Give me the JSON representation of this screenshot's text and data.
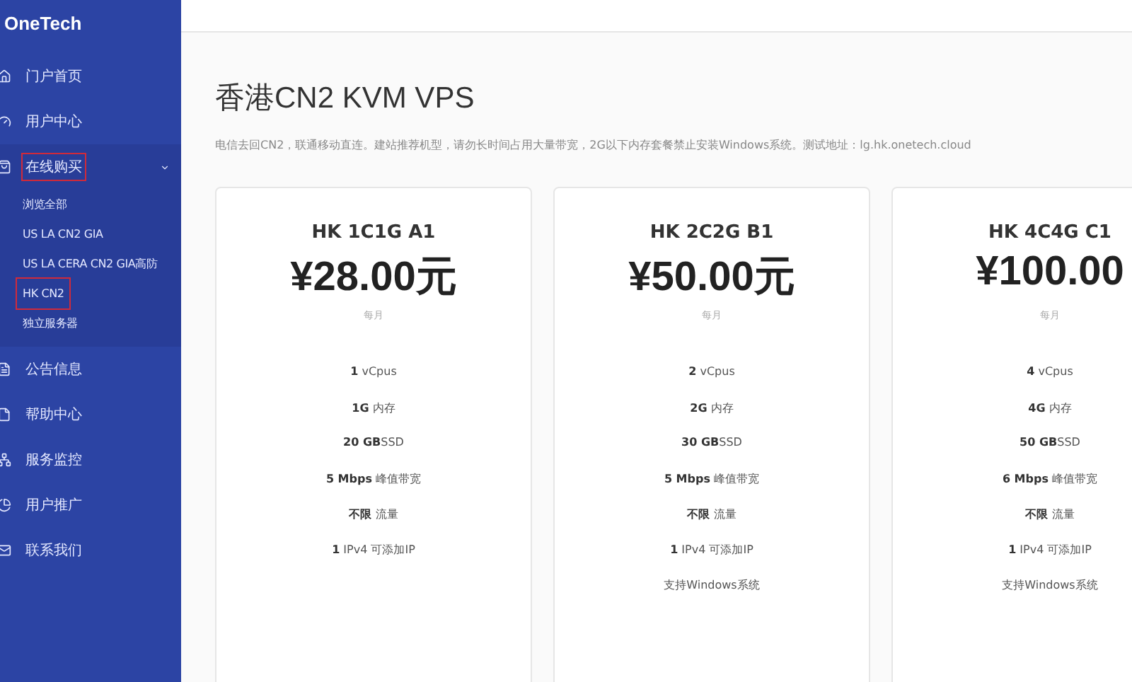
{
  "brand": "OneTech",
  "nav": [
    {
      "label": "门户首页",
      "expanded": false,
      "highlighted": false
    },
    {
      "label": "用户中心",
      "expanded": false,
      "highlighted": false
    },
    {
      "label": "在线购买",
      "expanded": true,
      "highlighted": true,
      "children": [
        {
          "label": "浏览全部",
          "highlighted": false
        },
        {
          "label": "US LA CN2 GIA",
          "highlighted": false
        },
        {
          "label": "US LA CERA CN2 GIA高防",
          "highlighted": false
        },
        {
          "label": "HK CN2",
          "highlighted": true
        },
        {
          "label": "独立服务器",
          "highlighted": false
        }
      ]
    },
    {
      "label": "公告信息",
      "expanded": false,
      "highlighted": false
    },
    {
      "label": "帮助中心",
      "expanded": false,
      "highlighted": false
    },
    {
      "label": "服务监控",
      "expanded": false,
      "highlighted": false
    },
    {
      "label": "用户推广",
      "expanded": false,
      "highlighted": false
    },
    {
      "label": "联系我们",
      "expanded": false,
      "highlighted": false
    }
  ],
  "page": {
    "title": "香港CN2 KVM VPS",
    "description": "电信去回CN2，联通移动直连。建站推荐机型，请勿长时间占用大量带宽，2G以下内存套餐禁止安装Windows系统。测试地址：lg.hk.onetech.cloud"
  },
  "plans": [
    {
      "name": "HK 1C1G A1",
      "price": "¥28.00元",
      "period": "每月",
      "features": [
        "**1** vCpus",
        "**1G** 内存",
        "**20 GB**SSD",
        "**5 Mbps** 峰值带宽",
        "**不限** 流量",
        "**1** IPv4 可添加IP"
      ]
    },
    {
      "name": "HK 2C2G B1",
      "price": "¥50.00元",
      "period": "每月",
      "features": [
        "**2** vCpus",
        "**2G** 内存",
        "**30 GB**SSD",
        "**5 Mbps** 峰值带宽",
        "**不限** 流量",
        "**1** IPv4 可添加IP",
        "支持Windows系统"
      ]
    },
    {
      "name": "HK 4C4G C1",
      "price": "¥100.00",
      "period": "每月",
      "features": [
        "**4** vCpus",
        "**4G** 内存",
        "**50 GB**SSD",
        "**6 Mbps** 峰值带宽",
        "**不限** 流量",
        "**1** IPv4 可添加IP",
        "支持Windows系统"
      ]
    }
  ]
}
